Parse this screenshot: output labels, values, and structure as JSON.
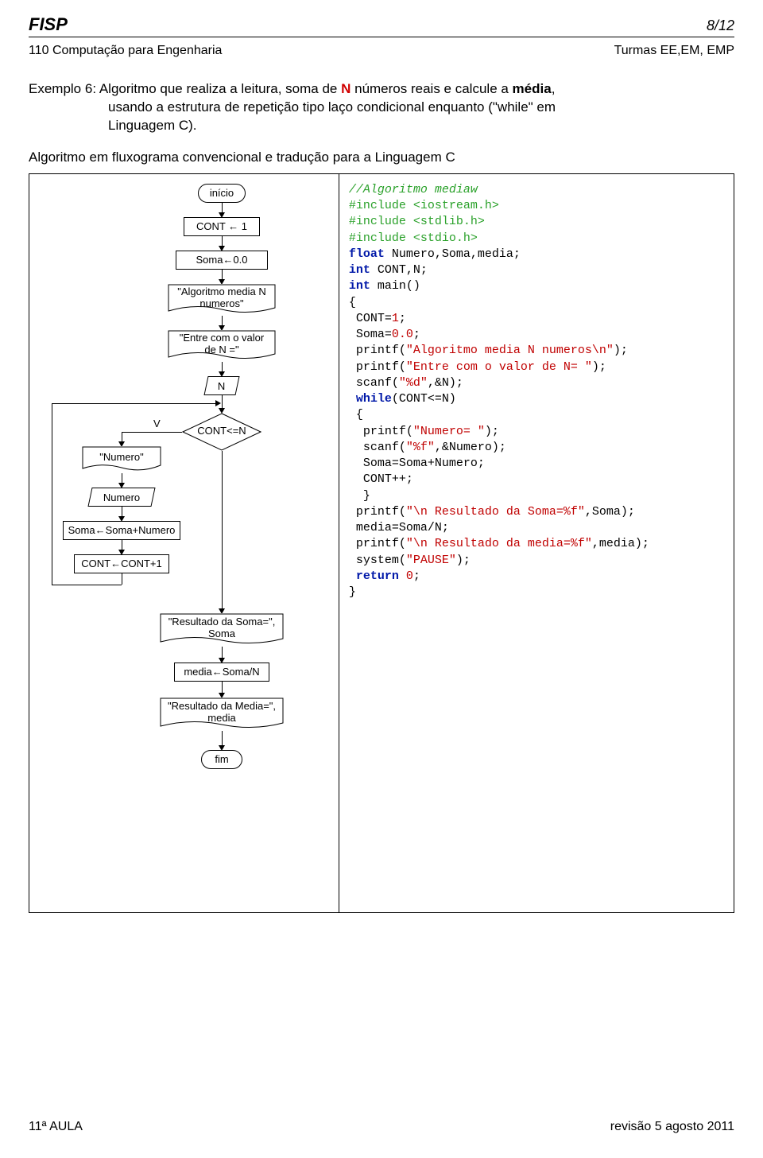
{
  "header": {
    "left": "FISP",
    "right": "8/12"
  },
  "subheader": {
    "left": "110 Computação para Engenharia",
    "right": "Turmas EE,EM, EMP"
  },
  "exemplo": {
    "label": "Exemplo 6:",
    "line1_a": "Algoritmo que realiza a leitura, soma de ",
    "line1_N": "N",
    "line1_b": " números reais e calcule a ",
    "line1_media": "média",
    "line1_c": ",",
    "line2": "usando a estrutura de repetição tipo laço condicional enquanto (\"while\" em",
    "line3": "Linguagem C)."
  },
  "algotitle": "Algoritmo em fluxograma convencional e tradução para a Linguagem C",
  "flow": {
    "start": "início",
    "b1": "CONT ← 1",
    "b2": "Soma←0.0",
    "d1": "\"Algoritmo media N\nnumeros\"",
    "d2": "\"Entre com o valor\nde N =\"",
    "io1": "N",
    "dec": "CONT<=N",
    "decV": "V",
    "d3": "\"Numero\"",
    "io2": "Numero",
    "b3": "Soma←Soma+Numero",
    "b4": "CONT←CONT+1",
    "d4": "\"Resultado da Soma=\",\nSoma",
    "b5": "media←Soma/N",
    "d5": "\"Resultado da Media=\",\nmedia",
    "end": "fim"
  },
  "code": {
    "c01": "//Algoritmo mediaw",
    "c02a": "#include ",
    "c02b": "<iostream.h>",
    "c03a": "#include ",
    "c03b": "<stdlib.h>",
    "c04a": "#include ",
    "c04b": "<stdio.h>",
    "c05a": "float",
    "c05b": " Numero,Soma,media;",
    "c06a": "int",
    "c06b": " CONT,N;",
    "c07a": "int",
    "c07b": " main()",
    "c08": "{",
    "c09a": " CONT=",
    "c09b": "1",
    "c09c": ";",
    "c10a": " Soma=",
    "c10b": "0.0",
    "c10c": ";",
    "c11a": " printf(",
    "c11b": "\"Algoritmo media N numeros\\n\"",
    "c11c": ");",
    "c12a": " printf(",
    "c12b": "\"Entre com o valor de N= \"",
    "c12c": ");",
    "c13a": " scanf(",
    "c13b": "\"%d\"",
    "c13c": ",&N);",
    "c14a": " ",
    "c14b": "while",
    "c14c": "(CONT<=N)",
    "c15": " {",
    "c16a": "  printf(",
    "c16b": "\"Numero= \"",
    "c16c": ");",
    "c17a": "  scanf(",
    "c17b": "\"%f\"",
    "c17c": ",&Numero);",
    "c18": "  Soma=Soma+Numero;",
    "c19": "  CONT++;",
    "c20": "  }",
    "c21a": " printf(",
    "c21b": "\"\\n Resultado da Soma=%f\"",
    "c21c": ",Soma);",
    "c22": " media=Soma/N;",
    "c23a": " printf(",
    "c23b": "\"\\n Resultado da media=%f\"",
    "c23c": ",media);",
    "c24a": " system(",
    "c24b": "\"PAUSE\"",
    "c24c": ");",
    "c25a": " ",
    "c25b": "return",
    "c25c": " ",
    "c25d": "0",
    "c25e": ";",
    "c26": "}"
  },
  "footer": {
    "left": "11ª AULA",
    "right": "revisão 5 agosto 2011"
  }
}
